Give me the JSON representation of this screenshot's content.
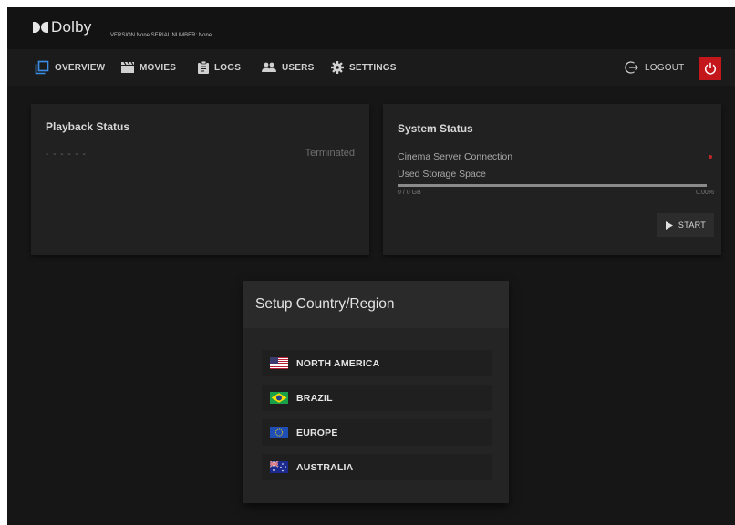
{
  "header": {
    "brand": "Dolby",
    "version_text": "VERSION None SERIAL NUMBER: None"
  },
  "nav": {
    "overview": "OVERVIEW",
    "movies": "MOVIES",
    "logs": "LOGS",
    "users": "USERS",
    "settings": "SETTINGS",
    "logout": "LOGOUT"
  },
  "playback": {
    "title": "Playback Status",
    "placeholder": "- - - - - -",
    "state": "Terminated"
  },
  "system": {
    "title": "System Status",
    "connection_label": "Cinema Server Connection",
    "storage_label": "Used Storage Space",
    "storage_used": "0 / 0 GB",
    "storage_percent_text": "0.00%",
    "storage_fraction": 0,
    "start_label": "START"
  },
  "dialog": {
    "title": "Setup Country/Region",
    "regions": [
      {
        "label": "NORTH AMERICA",
        "flag": "us-flag-icon"
      },
      {
        "label": "BRAZIL",
        "flag": "brazil-flag-icon"
      },
      {
        "label": "EUROPE",
        "flag": "eu-flag-icon"
      },
      {
        "label": "AUSTRALIA",
        "flag": "australia-flag-icon"
      }
    ]
  },
  "colors": {
    "accent_blue": "#3a8ee6",
    "power_red": "#c4171c",
    "status_red": "#c0282a"
  }
}
